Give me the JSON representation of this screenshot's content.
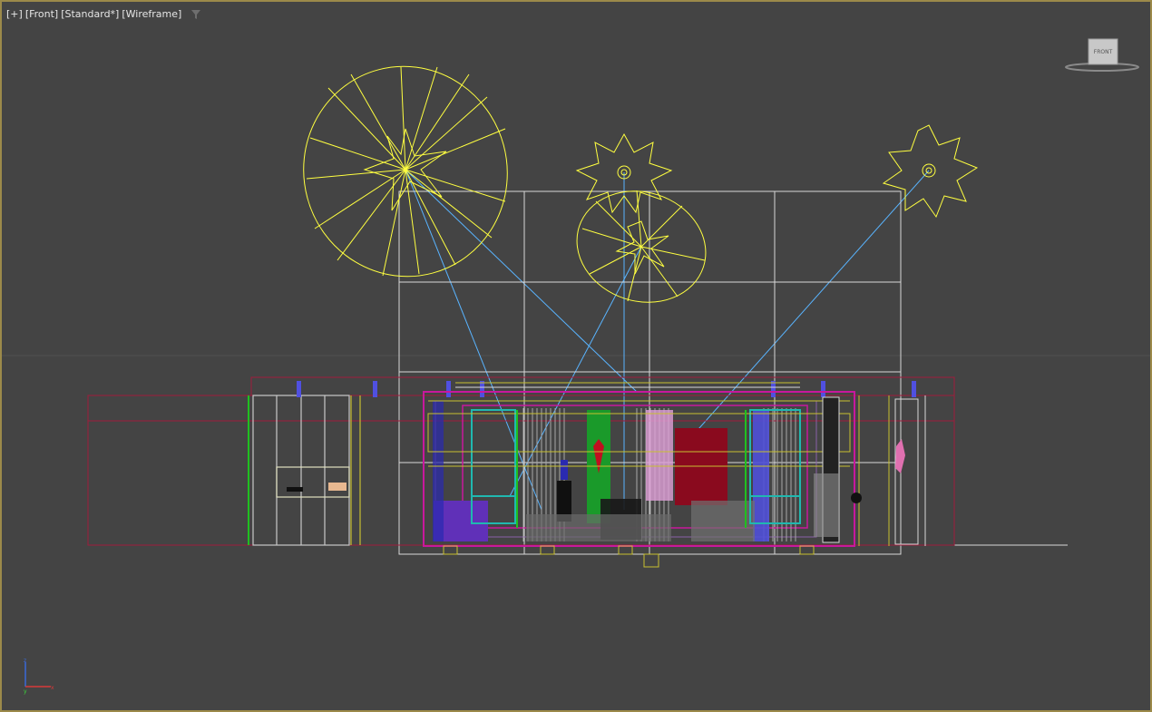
{
  "viewport": {
    "labels": [
      "[+]",
      "[Front]",
      "[Standard*]",
      "[Wireframe]"
    ],
    "filter_icon": "filter-funnel-icon",
    "viewcube_label": "FRONT",
    "axis_labels": {
      "up": "z",
      "right": "x",
      "origin": "y"
    }
  },
  "colors": {
    "background": "#444444",
    "viewport_border": "#9c8a4a",
    "light": "#ffff40",
    "light_target_line": "#59b4ff",
    "geometry_white": "#d8d8d8",
    "geometry_magenta": "#c8189c",
    "geometry_crimson": "#a01c3c",
    "geometry_green": "#20c020",
    "geometry_cyan": "#20b8b0",
    "geometry_blue": "#4040d8",
    "geometry_purple": "#7030c0",
    "geometry_red": "#a00014",
    "geometry_pink": "#e088c8"
  }
}
